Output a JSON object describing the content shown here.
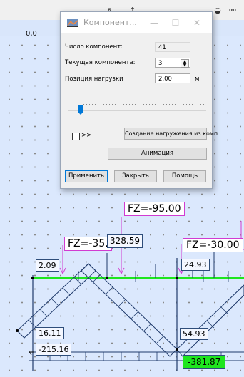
{
  "ruler": {
    "origin_label": "0,0"
  },
  "dialog": {
    "title": "Компонент...",
    "fields": {
      "count_label": "Число компонент:",
      "count_value": "41",
      "current_label": "Текущая компонента:",
      "current_value": "3",
      "position_label": "Позиция нагрузки",
      "position_value": "2,00",
      "position_unit": "м"
    },
    "slider": {
      "value_fraction": 0.05
    },
    "checkbox": {
      "label": ">>",
      "checked": false
    },
    "buttons": {
      "create_load": "Создание нагружения из комп.",
      "animation": "Анимация",
      "apply": "Применить",
      "close": "Закрыть",
      "help": "Помощь"
    }
  },
  "canvas": {
    "load_labels": [
      "FZ=-95.00",
      "FZ=-35.",
      "FZ=-30.00"
    ],
    "value_labels": [
      "328.59",
      "2.09",
      "24.93",
      "16.11",
      "54.93",
      "-215.16",
      "-381.87"
    ],
    "highlight_color": "#1ee61e",
    "load_color": "#d13bd1"
  }
}
